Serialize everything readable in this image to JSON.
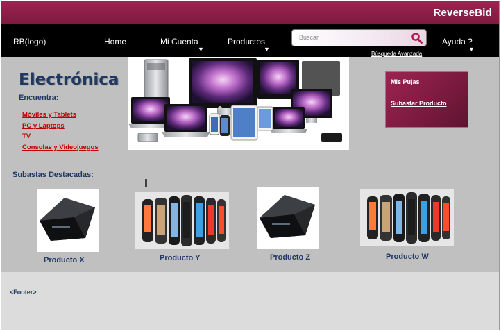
{
  "header": {
    "brand": "ReverseBid",
    "logo": "RB(logo)"
  },
  "nav": {
    "home": "Home",
    "account": "Mi Cuenta",
    "products": "Productos",
    "help": "Ayuda ?",
    "dropdown_glyph": "▼"
  },
  "search": {
    "placeholder": "Buscar",
    "icon": "search-icon",
    "advanced_label": "Búsqueda Avanzada"
  },
  "category": {
    "title": "Electrónica",
    "find_label": "Encuentra:",
    "links": [
      "Móviles y  Tablets",
      "PC y  Laptops",
      "TV",
      "Consolas y Videojuegos"
    ]
  },
  "user_panel": {
    "my_bids": "Mis Pujas",
    "auction_product": "Subastar Producto"
  },
  "featured": {
    "title": "Subastas Destacadas:",
    "products": [
      {
        "name": "Producto X",
        "image": "game-console-image"
      },
      {
        "name": "Producto Y",
        "image": "smart-bracelets-image"
      },
      {
        "name": "Producto Z",
        "image": "game-console-image"
      },
      {
        "name": "Producto W",
        "image": "smart-bracelets-image"
      }
    ]
  },
  "footer": {
    "label": "<Footer>"
  },
  "colors": {
    "brand_bar": "#8a1e47",
    "nav_bg": "#000000",
    "page_bg": "#c0c0c0",
    "footer_bg": "#dcdcdc",
    "heading": "#1f3864",
    "category_link": "#c00000"
  }
}
